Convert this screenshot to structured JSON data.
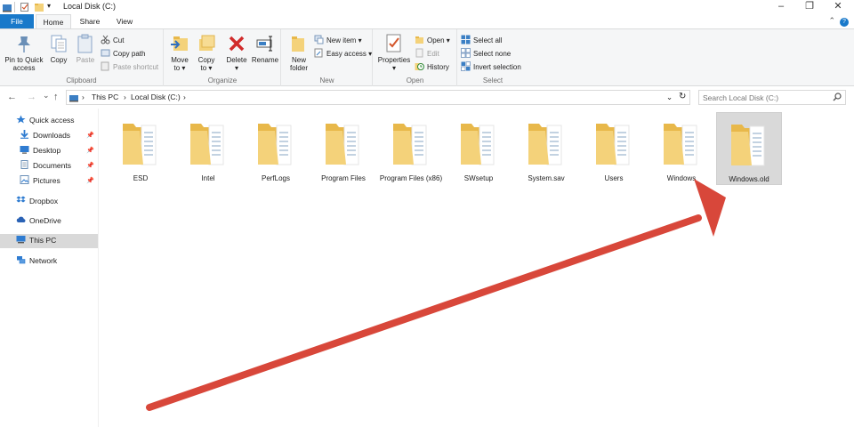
{
  "window": {
    "title": "Local Disk (C:)",
    "controls": [
      "–",
      "❐",
      "✕"
    ]
  },
  "tabs": [
    {
      "label": "File"
    },
    {
      "label": "Home"
    },
    {
      "label": "Share"
    },
    {
      "label": "View"
    }
  ],
  "ribbon": {
    "clipboard": {
      "label": "Clipboard",
      "pin_label_1": "Pin to Quick",
      "pin_label_2": "access",
      "copy_label": "Copy",
      "paste_label": "Paste",
      "cut_label": "Cut",
      "copy_path_label": "Copy path",
      "paste_shortcut_label": "Paste shortcut"
    },
    "organize": {
      "label": "Organize",
      "move_to_1": "Move",
      "move_to_2": "to ▾",
      "copy_to_1": "Copy",
      "copy_to_2": "to ▾",
      "delete_1": "Delete",
      "delete_2": "▾",
      "rename_label": "Rename"
    },
    "new": {
      "label": "New",
      "new_folder_1": "New",
      "new_folder_2": "folder",
      "new_item_label": "New item ▾",
      "easy_access_label": "Easy access ▾"
    },
    "open": {
      "label": "Open",
      "properties_1": "Properties",
      "properties_2": "▾",
      "open_label": "Open ▾",
      "edit_label": "Edit",
      "history_label": "History"
    },
    "select": {
      "label": "Select",
      "select_all_label": "Select all",
      "select_none_label": "Select none",
      "invert_label": "Invert selection"
    }
  },
  "address": {
    "back": "←",
    "forward": "→",
    "recent": "⌄",
    "up": "↑",
    "crumbs": [
      "This PC",
      "Local Disk (C:)"
    ],
    "separator": "›",
    "dropdown": "⌄",
    "refresh": "↻",
    "search_placeholder": "Search Local Disk (C:)"
  },
  "nav": {
    "items": [
      {
        "label": "Quick access",
        "icon": "star-icon"
      },
      {
        "label": "Downloads",
        "icon": "download-icon",
        "pinned": true
      },
      {
        "label": "Desktop",
        "icon": "desktop-icon",
        "pinned": true
      },
      {
        "label": "Documents",
        "icon": "document-icon",
        "pinned": true
      },
      {
        "label": "Pictures",
        "icon": "pictures-icon",
        "pinned": true
      },
      {
        "label": "Dropbox",
        "icon": "dropbox-icon"
      },
      {
        "label": "OneDrive",
        "icon": "cloud-icon"
      },
      {
        "label": "This PC",
        "icon": "computer-icon",
        "selected": true
      },
      {
        "label": "Network",
        "icon": "network-icon"
      }
    ]
  },
  "folders": [
    {
      "name": "ESD"
    },
    {
      "name": "Intel"
    },
    {
      "name": "PerfLogs"
    },
    {
      "name": "Program Files"
    },
    {
      "name": "Program Files (x86)"
    },
    {
      "name": "SWsetup"
    },
    {
      "name": "System.sav"
    },
    {
      "name": "Users"
    },
    {
      "name": "Windows"
    },
    {
      "name": "Windows.old",
      "selected": true
    }
  ],
  "colors": {
    "accent": "#1979ca",
    "folder": "#f4d27a",
    "folder_dark": "#e8b84a",
    "selection": "#d9d9d9",
    "arrow": "#d8473a"
  }
}
